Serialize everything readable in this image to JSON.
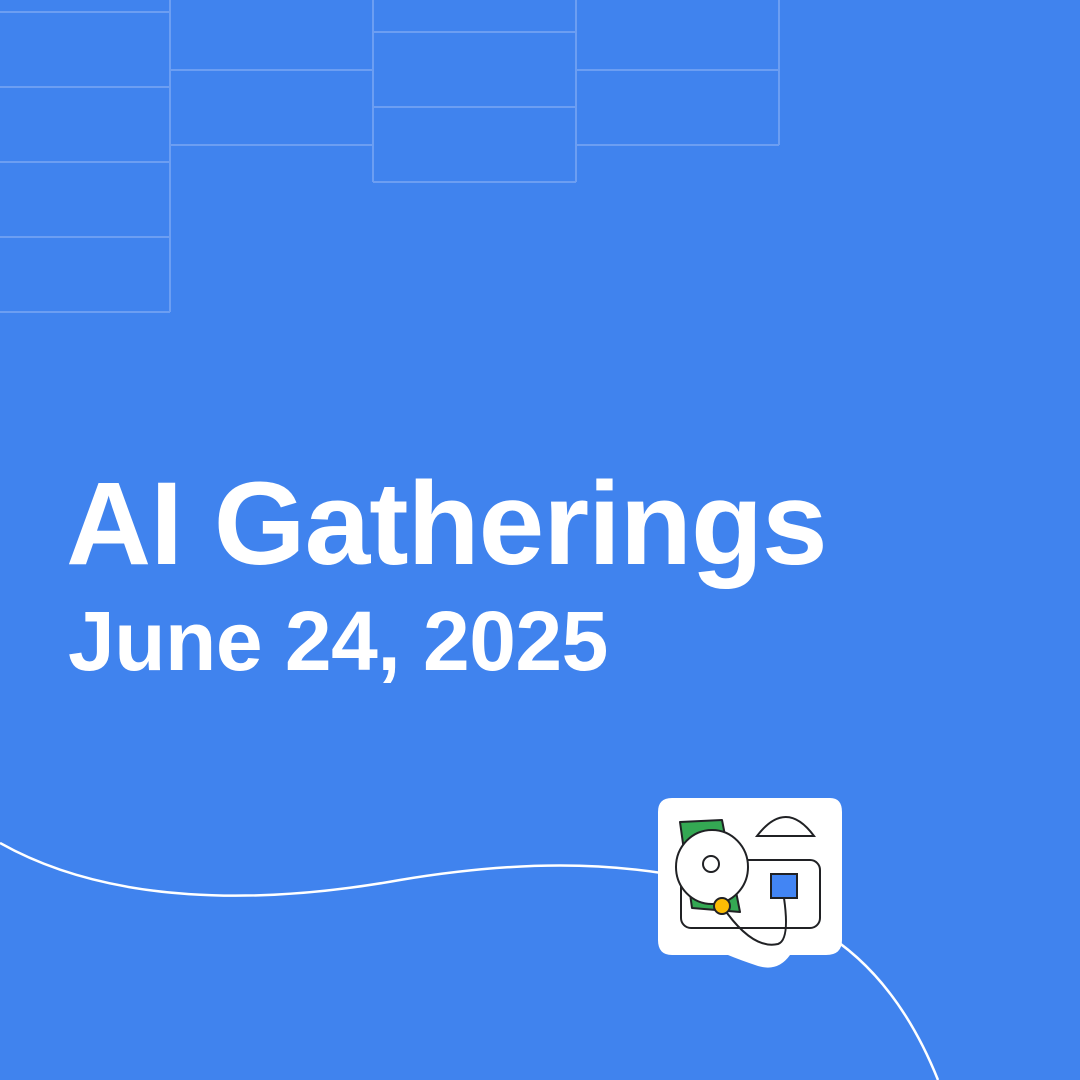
{
  "colors": {
    "background": "#4083EE",
    "text": "#FFFFFF",
    "grid_line": "#6C9EF2",
    "wave_line": "#FFFFFF",
    "sticker_bg": "#FFFFFF",
    "accent_green": "#34A853",
    "accent_yellow": "#FBBC04",
    "accent_blue": "#4285F4",
    "outline": "#202124"
  },
  "event": {
    "title": "AI Gatherings",
    "date": "June 24, 2025"
  },
  "graphics": {
    "background_pattern": "grid-lines",
    "divider": "wavy-line",
    "sticker_icon": "abstract-shapes-icon"
  }
}
